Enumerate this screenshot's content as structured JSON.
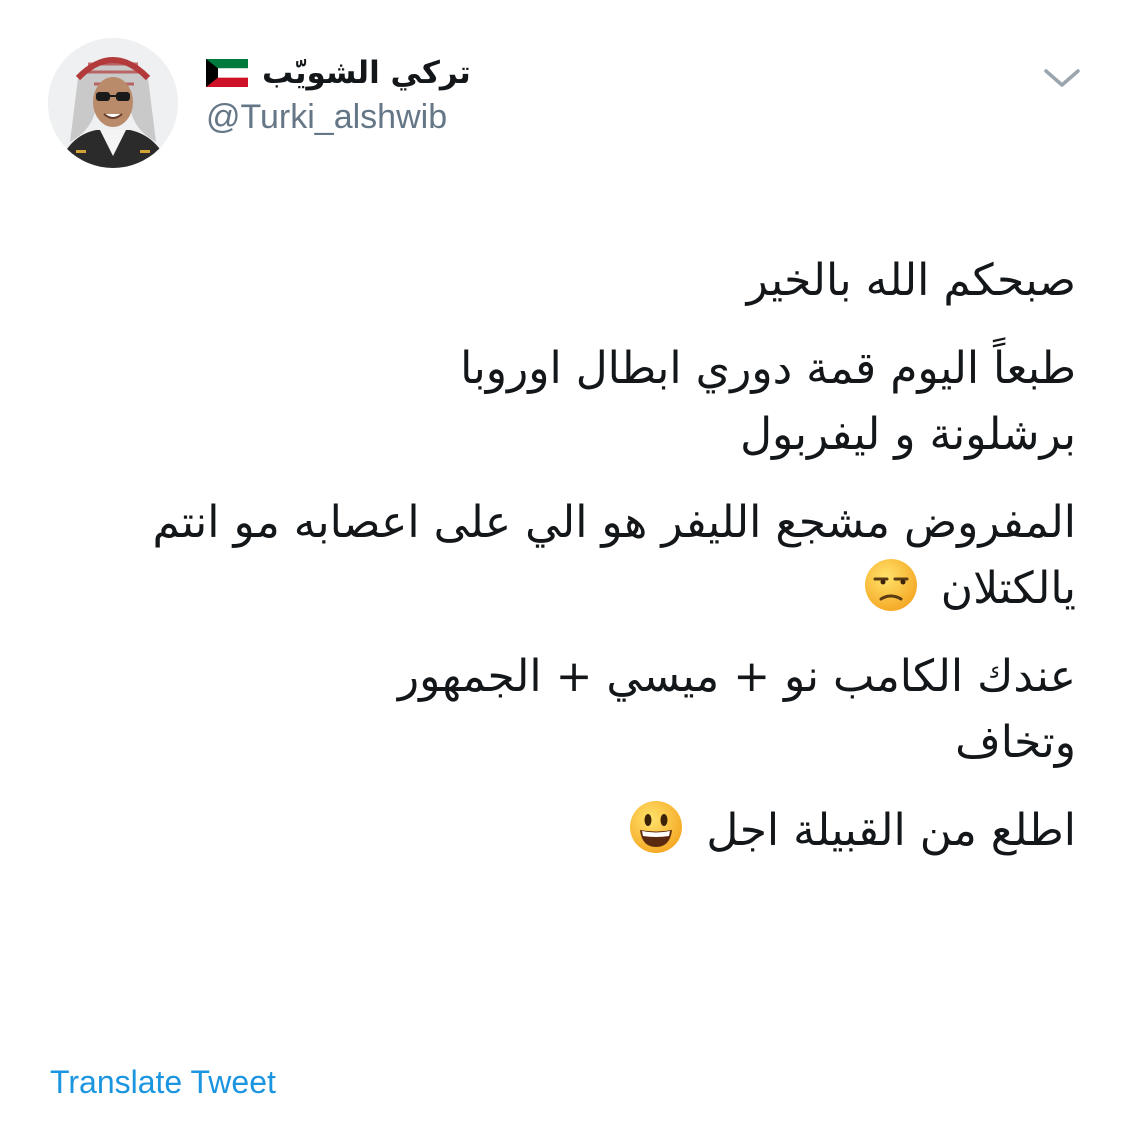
{
  "author": {
    "display_name": "تركي الشويّب",
    "handle": "@Turki_alshwib",
    "flag_icon": "kuwait-flag-icon",
    "avatar_icon": "profile-photo"
  },
  "menu": {
    "icon": "chevron-down-icon"
  },
  "tweet": {
    "p1_l1": "صبحكم الله بالخير",
    "p2_l1": "طبعاً اليوم قمة دوري ابطال اوروبا",
    "p2_l2": "برشلونة و ليفربول",
    "p3_l1": "المفروض مشجع الليفر هو الي على اعصابه مو انتم",
    "p3_l2": "يالكتلان",
    "p3_l2_emoji": "unamused-face-emoji",
    "p4_l1": "عندك الكامب نو + ميسي + الجمهور",
    "p4_l2": "وتخاف",
    "p5_l1": "اطلع من القبيلة اجل",
    "p5_l1_emoji": "grinning-face-emoji"
  },
  "actions": {
    "translate_label": "Translate Tweet"
  },
  "colors": {
    "text": "#14171a",
    "secondary": "#657786",
    "link": "#1b95e0",
    "kuwait_green": "#007a3d",
    "kuwait_red": "#ce1126"
  }
}
